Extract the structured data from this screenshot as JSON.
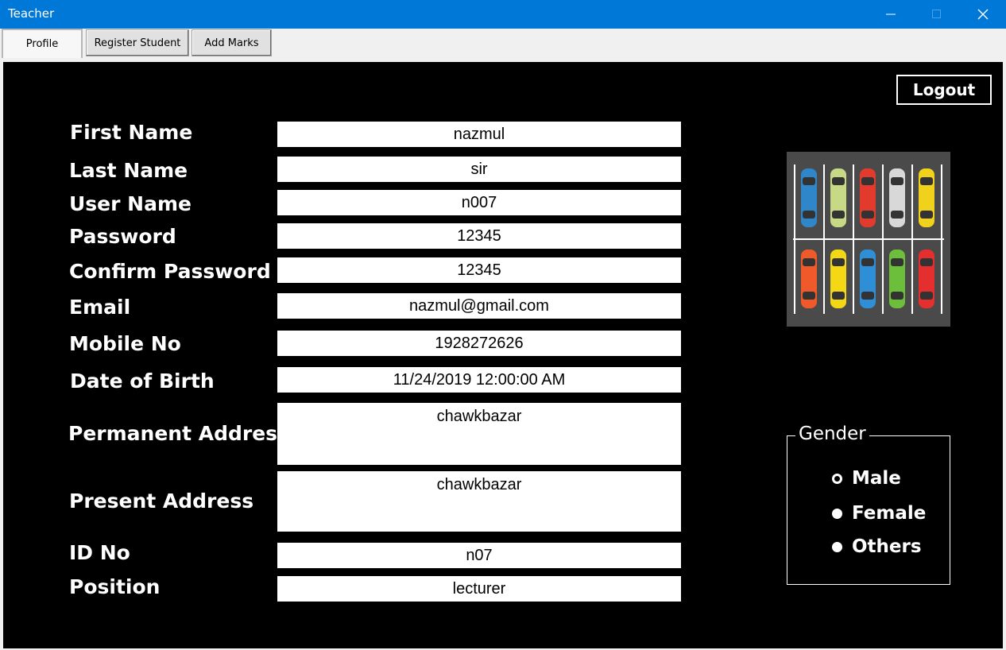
{
  "window": {
    "title": "Teacher"
  },
  "tabs": [
    {
      "label": "Profile",
      "active": true
    },
    {
      "label": "Register Student",
      "active": false
    },
    {
      "label": "Add Marks",
      "active": false
    }
  ],
  "logout_label": "Logout",
  "fields": [
    {
      "label": "First Name",
      "value": "nazmul"
    },
    {
      "label": "Last Name",
      "value": "sir"
    },
    {
      "label": "User Name",
      "value": "n007"
    },
    {
      "label": "Password",
      "value": "12345"
    },
    {
      "label": "Confirm Password",
      "value": "12345"
    },
    {
      "label": "Email",
      "value": "nazmul@gmail.com"
    },
    {
      "label": "Mobile No",
      "value": "1928272626"
    },
    {
      "label": "Date of Birth",
      "value": "11/24/2019 12:00:00 AM"
    },
    {
      "label": "Permanent Address",
      "value": "chawkbazar"
    },
    {
      "label": "Present Address",
      "value": "chawkbazar"
    },
    {
      "label": "ID No",
      "value": "n07"
    },
    {
      "label": "Position",
      "value": "lecturer"
    }
  ],
  "gender": {
    "legend": "Gender",
    "options": [
      {
        "label": "Male",
        "checked": true
      },
      {
        "label": "Female",
        "checked": false
      },
      {
        "label": "Others",
        "checked": false
      }
    ]
  },
  "image": {
    "icon": "parking-lot-icon",
    "car_colors_top": [
      "#2f86c9",
      "#c8d986",
      "#e23b2e",
      "#d8d8d8",
      "#f0d21c"
    ],
    "car_colors_bottom": [
      "#f05a2a",
      "#f4d816",
      "#2f8fd6",
      "#6cbf3a",
      "#e52f2f"
    ]
  }
}
